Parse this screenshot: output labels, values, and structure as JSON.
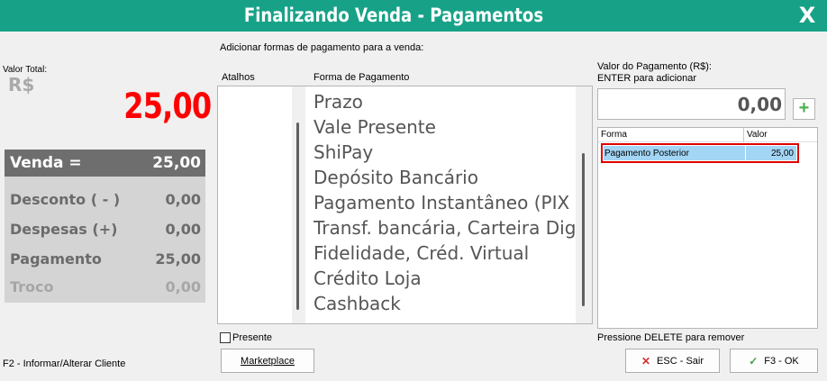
{
  "window": {
    "title": "Finalizando Venda - Pagamentos",
    "close_label": "X"
  },
  "left": {
    "total_label": "Valor Total:",
    "currency": "R$",
    "total_value": "25,00",
    "venda": {
      "label": "Venda =",
      "value": "25,00"
    },
    "rows": [
      {
        "label": "Desconto ( - )",
        "value": "0,00"
      },
      {
        "label": "Despesas (+)",
        "value": "0,00"
      },
      {
        "label": "Pagamento",
        "value": "25,00"
      },
      {
        "label": "Troco",
        "value": "0,00"
      }
    ],
    "f2_hint": "F2 - Informar/Alterar Cliente"
  },
  "middle": {
    "instruction": "Adicionar formas de pagamento para a venda:",
    "col_atalhos": "Atalhos",
    "col_forma": "Forma de Pagamento",
    "items": [
      "Prazo",
      "Vale Presente",
      "ShiPay",
      "Depósito Bancário",
      "Pagamento Instantâneo (PIX",
      "Transf. bancária, Carteira Dig",
      "Fidelidade, Créd. Virtual",
      "Crédito Loja",
      "Cashback"
    ],
    "presente_label": "Presente",
    "marketplace_label": "Marketplace"
  },
  "right": {
    "valor_label": "Valor do Pagamento (R$):",
    "enter_hint": "ENTER para adicionar",
    "valor_input": "0,00",
    "add_icon": "plus-icon",
    "grid_headers": {
      "forma": "Forma",
      "valor": "Valor"
    },
    "grid_rows": [
      {
        "forma": "Pagamento Posterior",
        "valor": "25,00"
      }
    ],
    "delete_hint": "Pressione DELETE para remover",
    "esc_label": "ESC - Sair",
    "ok_label": "F3 - OK"
  }
}
